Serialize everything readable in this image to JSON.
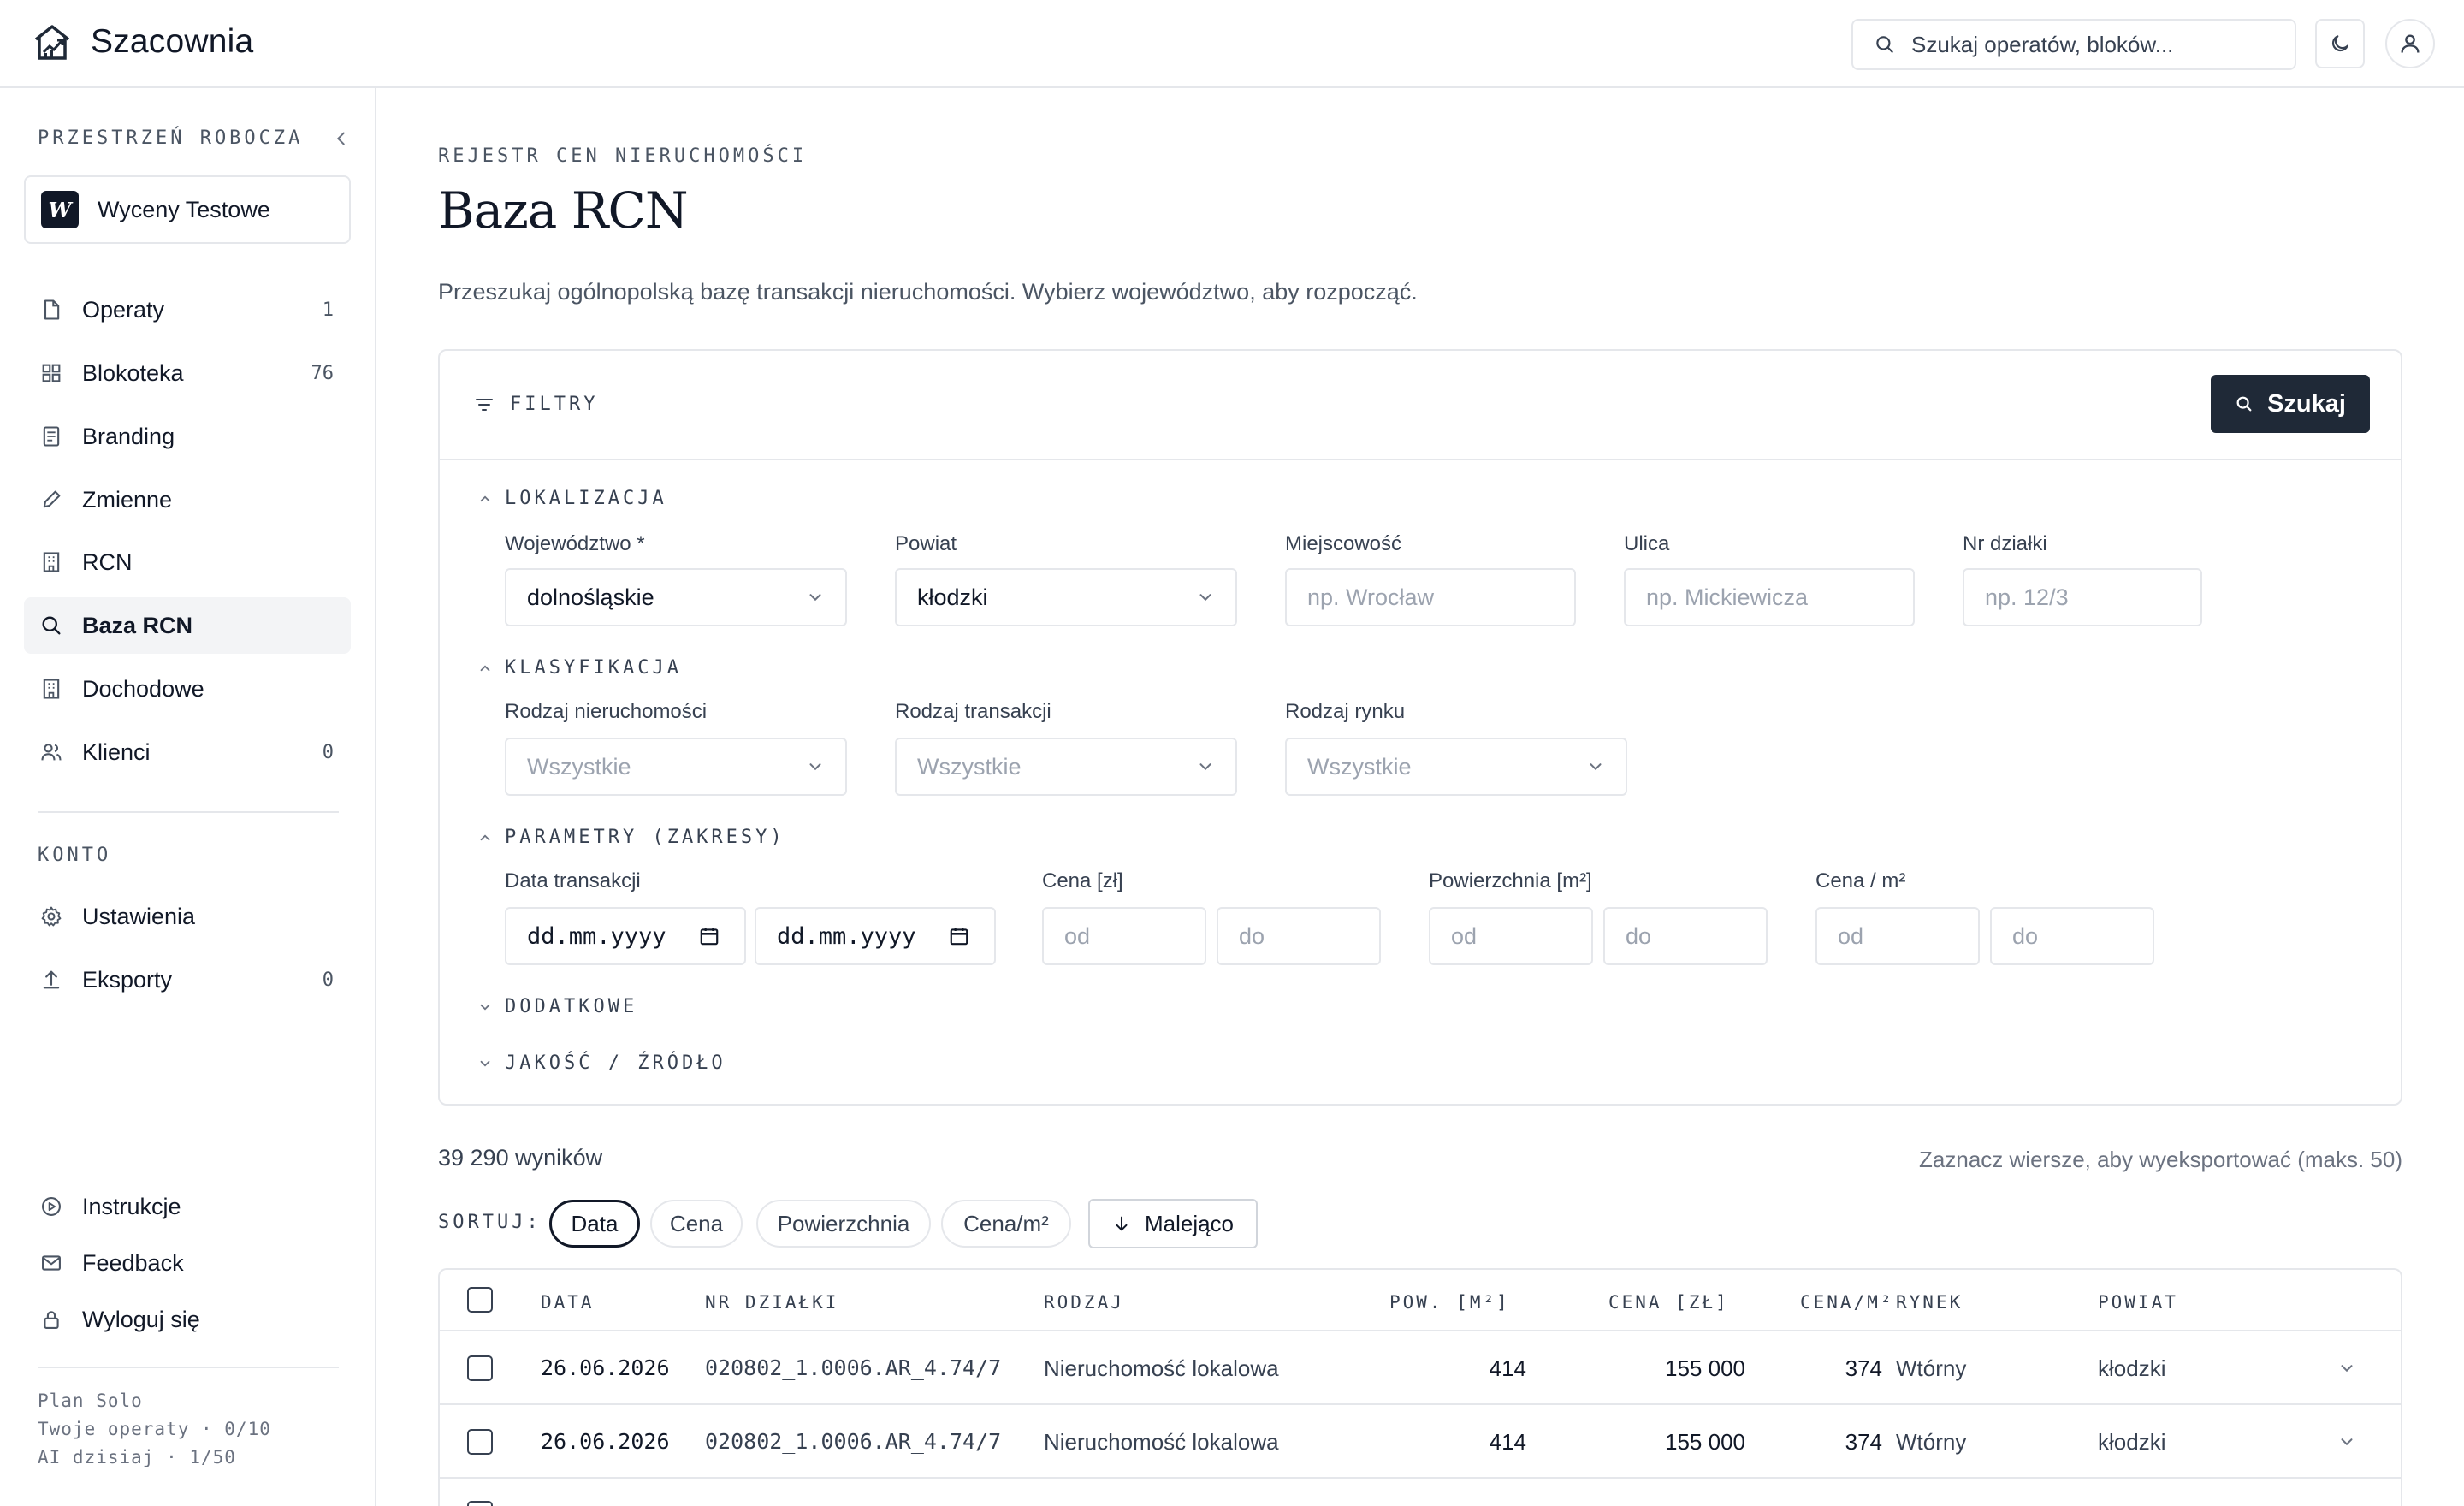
{
  "app": {
    "name": "Szacownia"
  },
  "header": {
    "search_placeholder": "Szukaj operatów, bloków..."
  },
  "sidebar": {
    "workspace_label": "PRZESTRZEŃ ROBOCZA",
    "workspace": {
      "badge": "W",
      "name": "Wyceny Testowe"
    },
    "items": [
      {
        "label": "Operaty",
        "count": "1",
        "icon": "file-icon"
      },
      {
        "label": "Blokoteka",
        "count": "76",
        "icon": "grid-icon"
      },
      {
        "label": "Branding",
        "count": "",
        "icon": "document-icon"
      },
      {
        "label": "Zmienne",
        "count": "",
        "icon": "pencil-icon"
      },
      {
        "label": "RCN",
        "count": "",
        "icon": "building-icon"
      },
      {
        "label": "Baza RCN",
        "count": "",
        "icon": "search-icon",
        "active": true
      },
      {
        "label": "Dochodowe",
        "count": "",
        "icon": "building-icon"
      },
      {
        "label": "Klienci",
        "count": "0",
        "icon": "users-icon"
      }
    ],
    "account_label": "KONTO",
    "account_items": [
      {
        "label": "Ustawienia",
        "count": "",
        "icon": "gear-icon"
      },
      {
        "label": "Eksporty",
        "count": "0",
        "icon": "upload-icon"
      }
    ],
    "bottom_items": [
      {
        "label": "Instrukcje",
        "icon": "play-circle-icon"
      },
      {
        "label": "Feedback",
        "icon": "mail-icon"
      },
      {
        "label": "Wyloguj się",
        "icon": "lock-icon"
      }
    ],
    "plan": {
      "line1": "Plan Solo",
      "line2": "Twoje operaty · 0/10",
      "line3": "AI dzisiaj · 1/50"
    }
  },
  "page": {
    "eyebrow": "REJESTR CEN NIERUCHOMOŚCI",
    "title": "Baza RCN",
    "subtitle": "Przeszukaj ogólnopolską bazę transakcji nieruchomości. Wybierz województwo, aby rozpocząć."
  },
  "filters": {
    "header": "FILTRY",
    "search_button": "Szukaj",
    "sections": {
      "location": "LOKALIZACJA",
      "classification": "KLASYFIKACJA",
      "params": "PARAMETRY (ZAKRESY)",
      "additional": "DODATKOWE",
      "quality": "JAKOŚĆ / ŹRÓDŁO"
    },
    "location": {
      "voivodeship_label": "Województwo *",
      "voivodeship_value": "dolnośląskie",
      "county_label": "Powiat",
      "county_value": "kłodzki",
      "city_label": "Miejscowość",
      "city_placeholder": "np. Wrocław",
      "street_label": "Ulica",
      "street_placeholder": "np. Mickiewicza",
      "plot_label": "Nr działki",
      "plot_placeholder": "np. 12/3"
    },
    "classification": {
      "property_type_label": "Rodzaj nieruchomości",
      "property_type_value": "Wszystkie",
      "transaction_type_label": "Rodzaj transakcji",
      "transaction_type_value": "Wszystkie",
      "market_type_label": "Rodzaj rynku",
      "market_type_value": "Wszystkie"
    },
    "params": {
      "date_label": "Data transakcji",
      "date_from": "dd.mm.yyyy",
      "date_to": "dd.mm.yyyy",
      "price_label": "Cena [zł]",
      "area_label": "Powierzchnia [m²]",
      "price_m2_label": "Cena / m²",
      "from_placeholder": "od",
      "to_placeholder": "do"
    }
  },
  "results": {
    "count": "39 290 wyników",
    "hint": "Zaznacz wiersze, aby wyeksportować (maks. 50)",
    "sort_label": "SORTUJ:",
    "sort_options": [
      "Data",
      "Cena",
      "Powierzchnia",
      "Cena/m²"
    ],
    "sort_active": "Data",
    "order_button": "Malejąco",
    "columns": [
      "DATA",
      "NR DZIAŁKI",
      "RODZAJ",
      "POW. [M²]",
      "CENA [ZŁ]",
      "CENA/M²",
      "RYNEK",
      "POWIAT"
    ],
    "rows": [
      {
        "date": "26.06.2026",
        "plot": "020802_1.0006.AR_4.74/7",
        "type": "Nieruchomość lokalowa",
        "area": "414",
        "price": "155 000",
        "price_m2": "374",
        "market": "Wtórny",
        "county": "kłodzki"
      },
      {
        "date": "26.06.2026",
        "plot": "020802_1.0006.AR_4.74/7",
        "type": "Nieruchomość lokalowa",
        "area": "414",
        "price": "155 000",
        "price_m2": "374",
        "market": "Wtórny",
        "county": "kłodzki"
      }
    ]
  },
  "colors": {
    "primary": "#1f2937",
    "border": "#e5e7eb",
    "muted": "#6b7280",
    "active_bg": "#f3f4f6"
  }
}
